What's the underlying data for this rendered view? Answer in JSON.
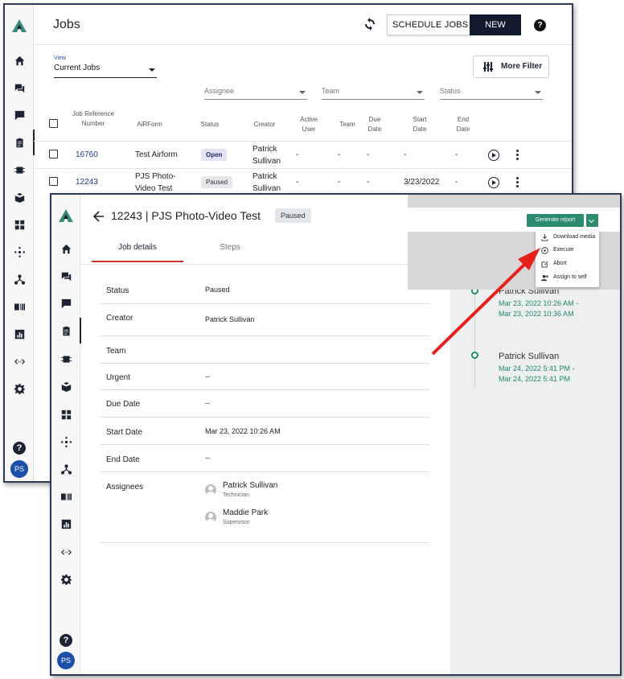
{
  "back_window": {
    "title": "Jobs",
    "schedule_label": "SCHEDULE JOBS",
    "new_label": "NEW",
    "help_label": "?",
    "view": {
      "label": "View",
      "value": "Current Jobs"
    },
    "more_filter_label": "More Filter",
    "filters": [
      "Assignee",
      "Team",
      "Status"
    ],
    "columns": [
      "Job Reference Number",
      "AiRForm",
      "Status",
      "Creator",
      "Active User",
      "Team",
      "Due Date",
      "Start Date",
      "End Date"
    ],
    "rows": [
      {
        "ref": "16760",
        "form": "Test Airform",
        "status": "Open",
        "creator": "Patrick Sullivan",
        "active": "-",
        "team": "-",
        "due": "-",
        "start": "-",
        "end": "-"
      },
      {
        "ref": "12243",
        "form": "PJS Photo-Video Test",
        "status": "Paused",
        "creator": "Patrick Sullivan",
        "active": "-",
        "team": "-",
        "due": "-",
        "start": "3/23/2022",
        "end": "-"
      }
    ],
    "user_initials": "PS"
  },
  "front_window": {
    "title": "12243 | PJS Photo-Video Test",
    "status_badge": "Paused",
    "tabs": [
      "Job details",
      "Steps"
    ],
    "details": {
      "status": {
        "key": "Status",
        "value": "Paused"
      },
      "creator": {
        "key": "Creator",
        "value": "Patrick Sullivan"
      },
      "team": {
        "key": "Team",
        "value": ""
      },
      "urgent": {
        "key": "Urgent",
        "value": "--"
      },
      "due": {
        "key": "Due Date",
        "value": "--"
      },
      "start": {
        "key": "Start Date",
        "value": "Mar 23, 2022 10:26 AM"
      },
      "end": {
        "key": "End Date",
        "value": "--"
      },
      "assignees_key": "Assignees"
    },
    "assignees": [
      {
        "name": "Patrick Sullivan",
        "role": "Technician"
      },
      {
        "name": "Maddie Park",
        "role": "Supervisor"
      }
    ],
    "generate_report_label": "Generate report",
    "report_menu": [
      "Download media",
      "Execute",
      "Abort",
      "Assign to self"
    ],
    "timeline": [
      {
        "name": "Patrick Sullivan",
        "from": "Mar 23, 2022 10:26 AM -",
        "to": "Mar 23, 2022 10:36 AM"
      },
      {
        "name": "Patrick Sullivan",
        "from": "Mar 24, 2022 5:41 PM -",
        "to": "Mar 24, 2022 5:41 PM"
      }
    ],
    "help_label": "?",
    "user_initials": "PS"
  },
  "colors": {
    "accent_green": "#2c8a6e",
    "arrow_red": "#e8201c",
    "tab_underline": "#d3332f",
    "nav_dark": "#121a30",
    "avatar_blue": "#1e4fa8"
  }
}
